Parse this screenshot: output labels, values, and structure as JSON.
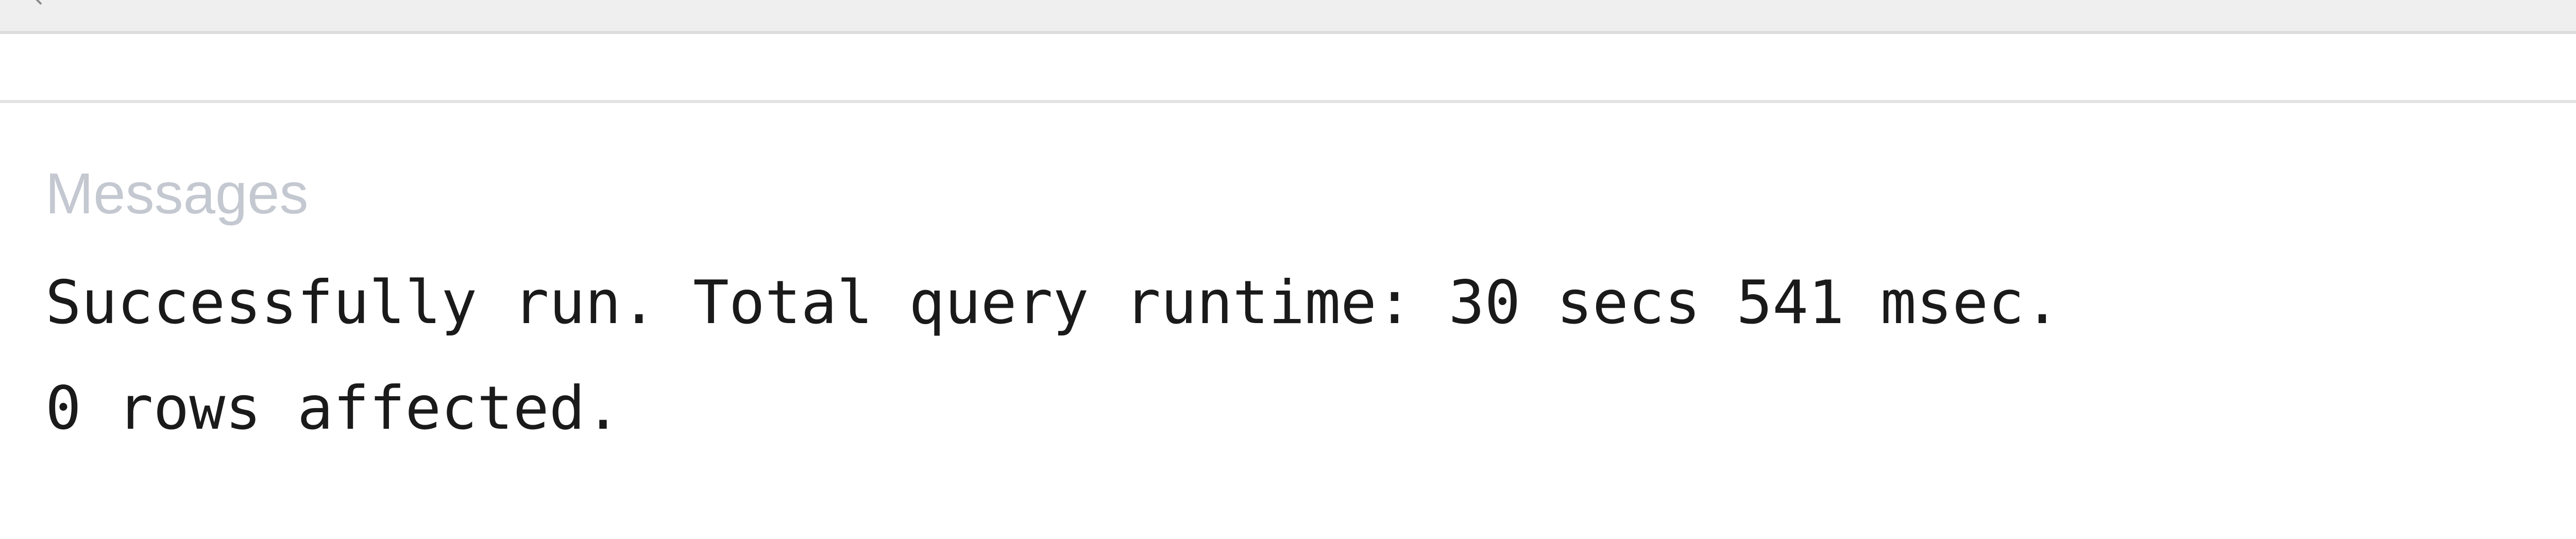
{
  "messages": {
    "header": "Messages",
    "lines": [
      "Successfully run. Total query runtime: 30 secs 541 msec.",
      "0 rows affected."
    ]
  },
  "icons": {
    "scroll_arrow": "chevron-left-icon"
  }
}
